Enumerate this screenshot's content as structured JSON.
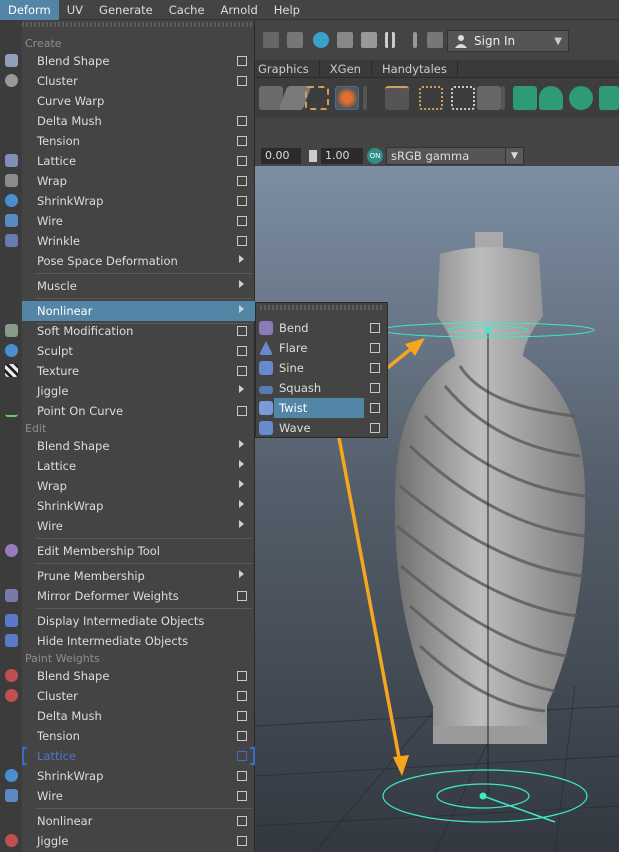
{
  "menubar": {
    "items": [
      "Deform",
      "UV",
      "Generate",
      "Cache",
      "Arnold",
      "Help"
    ],
    "active": "Deform"
  },
  "toolbar": {
    "sign_in_label": "Sign In"
  },
  "tabs": [
    "Graphics",
    "XGen",
    "Handytales"
  ],
  "viewbar": {
    "value_a": "0.00",
    "value_b": "1.00",
    "on_badge": "ON",
    "color_space": "sRGB gamma"
  },
  "deform_menu": {
    "create_header": "Create",
    "create_items": [
      {
        "label": "Blend Shape",
        "option_box": true
      },
      {
        "label": "Cluster",
        "option_box": true
      },
      {
        "label": "Curve Warp",
        "option_box": false
      },
      {
        "label": "Delta Mush",
        "option_box": true
      },
      {
        "label": "Tension",
        "option_box": true
      },
      {
        "label": "Lattice",
        "option_box": true
      },
      {
        "label": "Wrap",
        "option_box": true
      },
      {
        "label": "ShrinkWrap",
        "option_box": true
      },
      {
        "label": "Wire",
        "option_box": true
      },
      {
        "label": "Wrinkle",
        "option_box": true
      },
      {
        "label": "Pose Space Deformation",
        "submenu": true
      }
    ],
    "muscle_label": "Muscle",
    "nonlinear_label": "Nonlinear",
    "more_items": [
      {
        "label": "Soft Modification",
        "option_box": true
      },
      {
        "label": "Sculpt",
        "option_box": true
      },
      {
        "label": "Texture",
        "option_box": true
      },
      {
        "label": "Jiggle",
        "submenu": true
      },
      {
        "label": "Point On Curve",
        "option_box": true
      }
    ],
    "edit_header": "Edit",
    "edit_items": [
      {
        "label": "Blend Shape"
      },
      {
        "label": "Lattice"
      },
      {
        "label": "Wrap"
      },
      {
        "label": "ShrinkWrap"
      },
      {
        "label": "Wire"
      }
    ],
    "edit_membership": "Edit Membership Tool",
    "prune_membership": "Prune Membership",
    "mirror_weights": "Mirror Deformer Weights",
    "display_intermediate": "Display Intermediate Objects",
    "hide_intermediate": "Hide Intermediate Objects",
    "paint_header": "Paint Weights",
    "paint_items": [
      {
        "label": "Blend Shape"
      },
      {
        "label": "Cluster"
      },
      {
        "label": "Delta Mush"
      },
      {
        "label": "Tension"
      },
      {
        "label": "Lattice"
      },
      {
        "label": "ShrinkWrap"
      },
      {
        "label": "Wire"
      }
    ],
    "paint_items_2": [
      {
        "label": "Nonlinear"
      },
      {
        "label": "Jiggle"
      }
    ]
  },
  "nonlinear_submenu": {
    "items": [
      "Bend",
      "Flare",
      "Sine",
      "Squash",
      "Twist",
      "Wave"
    ],
    "highlighted": "Twist"
  },
  "colors": {
    "accent": "#5285a6",
    "arrow": "#f4a71e",
    "gizmo": "#3ee8c8",
    "menu_bg": "#444444"
  },
  "icons": [
    "user-icon",
    "ipr-render-icon",
    "snapshot-icon",
    "lasso-icon",
    "pause-icon",
    "lattice-icon",
    "cluster-icon",
    "bend-icon",
    "flare-icon",
    "sine-icon",
    "squash-icon",
    "twist-icon",
    "wave-icon"
  ]
}
